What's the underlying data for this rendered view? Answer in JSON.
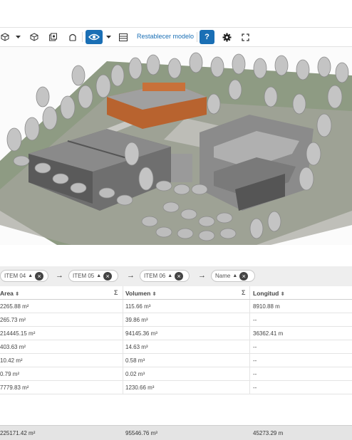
{
  "toolbar": {
    "reset_label": "Restablecer modelo",
    "help_label": "?",
    "icons": [
      "cube-icon",
      "chevron-down-icon",
      "box-icon",
      "layers-icon",
      "arch-icon",
      "eye-icon",
      "chevron-down-icon",
      "table-icon",
      "help-icon",
      "gear-icon",
      "fullscreen-icon"
    ],
    "accent": "#1a6fb5"
  },
  "grouping": {
    "chips": [
      {
        "label": "ITEM 04"
      },
      {
        "label": "ITEM 05"
      },
      {
        "label": "ITEM 06"
      },
      {
        "label": "Name"
      }
    ]
  },
  "table": {
    "columns": [
      {
        "label": "Area",
        "sigma": "Σ"
      },
      {
        "label": "Volumen",
        "sigma": "Σ"
      },
      {
        "label": "Longitud"
      }
    ],
    "rows": [
      [
        "2265.88 m²",
        "115.66 m³",
        "8910.88 m"
      ],
      [
        "265.73 m²",
        "39.86 m³",
        "--"
      ],
      [
        "214445.15 m²",
        "94145.36 m³",
        "36362.41 m"
      ],
      [
        "403.63 m²",
        "14.63 m³",
        "--"
      ],
      [
        "10.42 m²",
        "0.58 m³",
        "--"
      ],
      [
        "0.79 m²",
        "0.02 m³",
        "--"
      ],
      [
        "7779.83 m²",
        "1230.66 m³",
        "--"
      ]
    ],
    "totals": [
      "225171.42 m²",
      "95546.76 m³",
      "45273.29 m"
    ]
  }
}
